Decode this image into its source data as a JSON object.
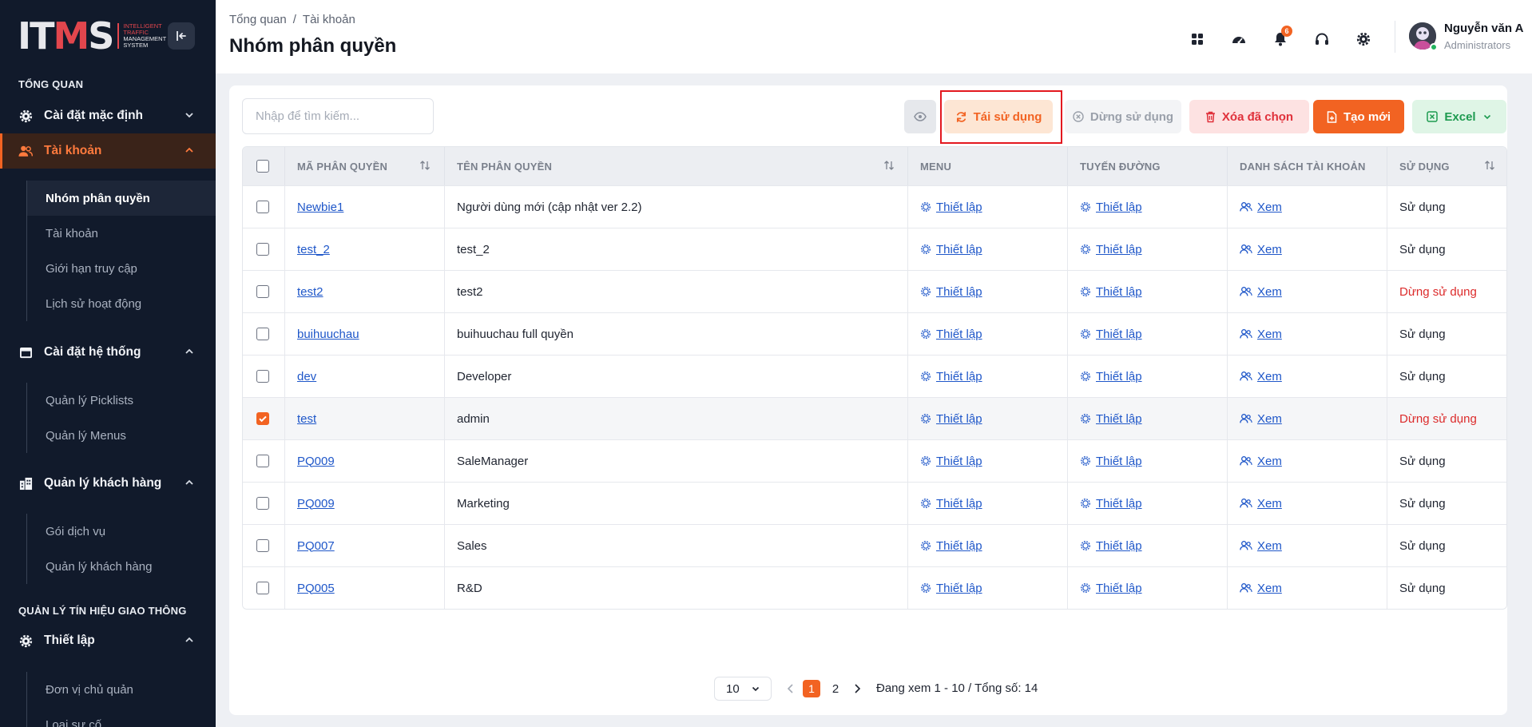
{
  "logo": {
    "text_main": "IT",
    "text_m": "M",
    "text_s": "S",
    "sub_line1": "INTELLIGENT",
    "sub_line2": "TRAFFIC",
    "sub_line3": "MANAGEMENT",
    "sub_line4": "SYSTEM"
  },
  "sidebar": {
    "section_overview": "TỔNG QUAN",
    "group_default_settings": "Cài đặt mặc định",
    "group_accounts": "Tài khoản",
    "accounts_items": [
      "Nhóm phân quyền",
      "Tài khoản",
      "Giới hạn truy cập",
      "Lịch sử hoạt động"
    ],
    "group_system": "Cài đặt hệ thống",
    "system_items": [
      "Quản lý Picklists",
      "Quản lý Menus"
    ],
    "group_customers": "Quản lý khách hàng",
    "customer_items": [
      "Gói dịch vụ",
      "Quản lý khách hàng"
    ],
    "section_traffic": "QUẢN LÝ TÍN HIỆU GIAO THÔNG",
    "group_setup": "Thiết lập",
    "setup_items": [
      "Đơn vị chủ quản",
      "Loại sự cố"
    ]
  },
  "header": {
    "breadcrumb": [
      "Tổng quan",
      "/",
      "Tài khoản"
    ],
    "title": "Nhóm phân quyền",
    "notification_count": "6",
    "user_name": "Nguyễn văn A",
    "user_role": "Administrators"
  },
  "toolbar": {
    "search_placeholder": "Nhập để tìm kiếm...",
    "reuse_label": "Tái sử dụng",
    "stop_label": "Dừng sử dụng",
    "delete_label": "Xóa đã chọn",
    "create_label": "Tạo mới",
    "excel_label": "Excel"
  },
  "table": {
    "columns": [
      "MÃ PHÂN QUYỀN",
      "TÊN PHÂN QUYỀN",
      "MENU",
      "TUYẾN ĐƯỜNG",
      "DANH SÁCH TÀI KHOẢN",
      "SỬ DỤNG"
    ],
    "rows": [
      {
        "code": "Newbie1",
        "name": "Người dùng mới (cập nhật ver 2.2)",
        "menu": "Thiết lập",
        "route": "Thiết lập",
        "accounts": "Xem",
        "status": "Sử dụng",
        "active": true,
        "checked": false
      },
      {
        "code": "test_2",
        "name": "test_2",
        "menu": "Thiết lập",
        "route": "Thiết lập",
        "accounts": "Xem",
        "status": "Sử dụng",
        "active": true,
        "checked": false
      },
      {
        "code": "test2",
        "name": "test2",
        "menu": "Thiết lập",
        "route": "Thiết lập",
        "accounts": "Xem",
        "status": "Dừng sử dụng",
        "active": false,
        "checked": false
      },
      {
        "code": "buihuuchau",
        "name": "buihuuchau full quyền",
        "menu": "Thiết lập",
        "route": "Thiết lập",
        "accounts": "Xem",
        "status": "Sử dụng",
        "active": true,
        "checked": false
      },
      {
        "code": "dev",
        "name": "Developer",
        "menu": "Thiết lập",
        "route": "Thiết lập",
        "accounts": "Xem",
        "status": "Sử dụng",
        "active": true,
        "checked": false
      },
      {
        "code": "test",
        "name": "admin",
        "menu": "Thiết lập",
        "route": "Thiết lập",
        "accounts": "Xem",
        "status": "Dừng sử dụng",
        "active": false,
        "checked": true
      },
      {
        "code": "PQ009",
        "name": "SaleManager",
        "menu": "Thiết lập",
        "route": "Thiết lập",
        "accounts": "Xem",
        "status": "Sử dụng",
        "active": true,
        "checked": false
      },
      {
        "code": "PQ009",
        "name": "Marketing",
        "menu": "Thiết lập",
        "route": "Thiết lập",
        "accounts": "Xem",
        "status": "Sử dụng",
        "active": true,
        "checked": false
      },
      {
        "code": "PQ007",
        "name": "Sales",
        "menu": "Thiết lập",
        "route": "Thiết lập",
        "accounts": "Xem",
        "status": "Sử dụng",
        "active": true,
        "checked": false
      },
      {
        "code": "PQ005",
        "name": "R&D",
        "menu": "Thiết lập",
        "route": "Thiết lập",
        "accounts": "Xem",
        "status": "Sử dụng",
        "active": true,
        "checked": false
      }
    ]
  },
  "pagination": {
    "page_size": "10",
    "pages": [
      "1",
      "2"
    ],
    "current_page": "1",
    "info": "Đang xem 1 - 10 / Tổng số: 14"
  },
  "colors": {
    "accent": "#f26322",
    "sidebar_bg": "#111a2b",
    "link": "#1f57c9",
    "danger": "#dc2b2b",
    "highlight_box": "#e3181f"
  }
}
